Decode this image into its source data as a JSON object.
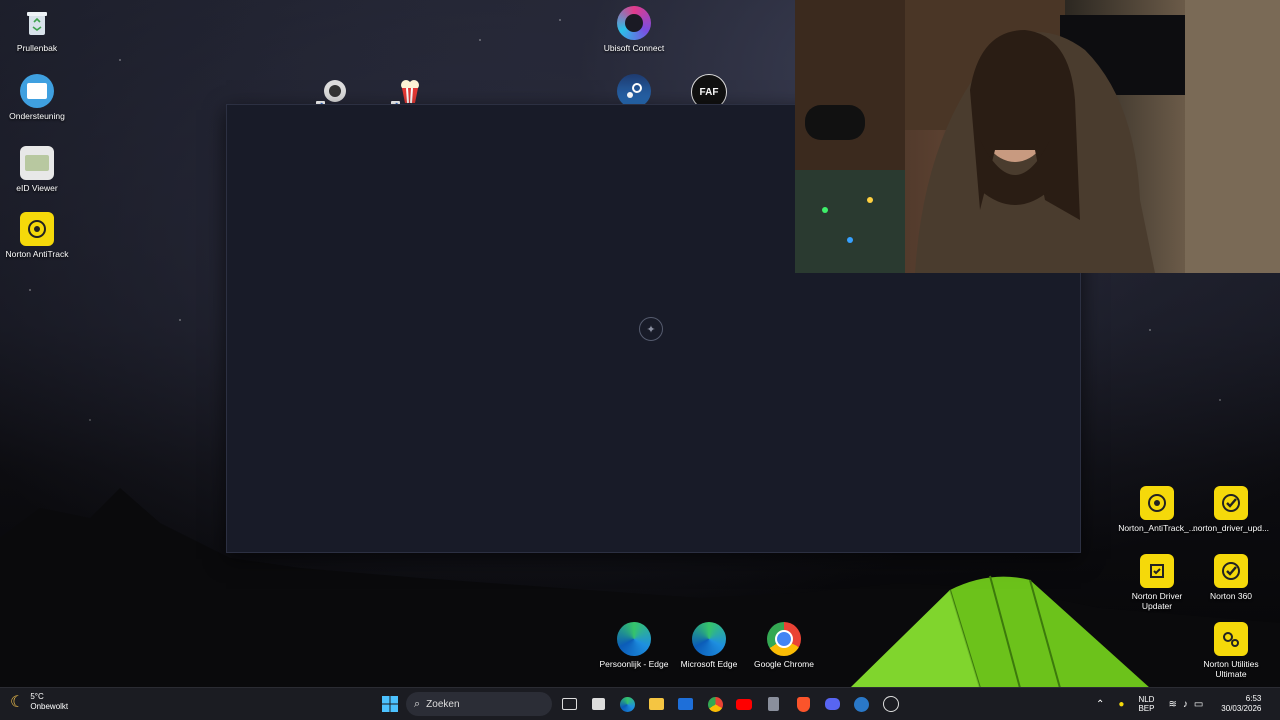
{
  "desktop": {
    "icons_left": [
      {
        "label": "Prullenbak",
        "icon": "recycle-bin-icon"
      },
      {
        "label": "Ondersteuning",
        "icon": "support-icon"
      },
      {
        "label": "eID Viewer",
        "icon": "eid-viewer-icon"
      },
      {
        "label": "Norton AntiTrack",
        "icon": "norton-antitrack-icon"
      }
    ],
    "icons_top": [
      {
        "label": "Ubisoft Connect",
        "icon": "ubisoft-icon"
      },
      {
        "label": "",
        "icon": "game-launcher-icon"
      },
      {
        "label": "",
        "icon": "popcorn-icon"
      },
      {
        "label": "",
        "icon": "steam-icon"
      },
      {
        "label": "",
        "icon": "faf-icon"
      }
    ],
    "icons_right": [
      {
        "label": "Norton_AntiTrack_...",
        "icon": "norton-antitrack-icon"
      },
      {
        "label": "norton_driver_upd...",
        "icon": "norton-check-icon"
      },
      {
        "label": "Norton Driver Updater",
        "icon": "norton-driver-icon"
      },
      {
        "label": "Norton 360",
        "icon": "norton-360-icon"
      },
      {
        "label": "Norton Utilities Ultimate",
        "icon": "norton-utilities-icon"
      }
    ],
    "icons_bottom": [
      {
        "label": "Persoonlijk - Edge",
        "icon": "edge-icon"
      },
      {
        "label": "Microsoft Edge",
        "icon": "edge-icon"
      },
      {
        "label": "Google Chrome",
        "icon": "chrome-icon"
      }
    ]
  },
  "taskbar": {
    "weather_temp": "5°C",
    "weather_desc": "Onbewolkt",
    "search_placeholder": "Zoeken",
    "language_top": "NLD",
    "language_bottom": "BEP",
    "time": "6:53",
    "date": "30/03/2026",
    "pinned": [
      "task-view-icon",
      "store-icon",
      "edge-icon",
      "file-explorer-icon",
      "mail-icon",
      "chrome-icon",
      "youtube-icon",
      "calculator-icon",
      "brave-icon",
      "discord-icon",
      "steam-icon",
      "app-launcher-icon"
    ]
  },
  "colors": {
    "norton_yellow": "#f5d90a",
    "window_bg": "#181b28",
    "taskbar_bg": "#1b1c22",
    "tent_green": "#7ed321"
  }
}
